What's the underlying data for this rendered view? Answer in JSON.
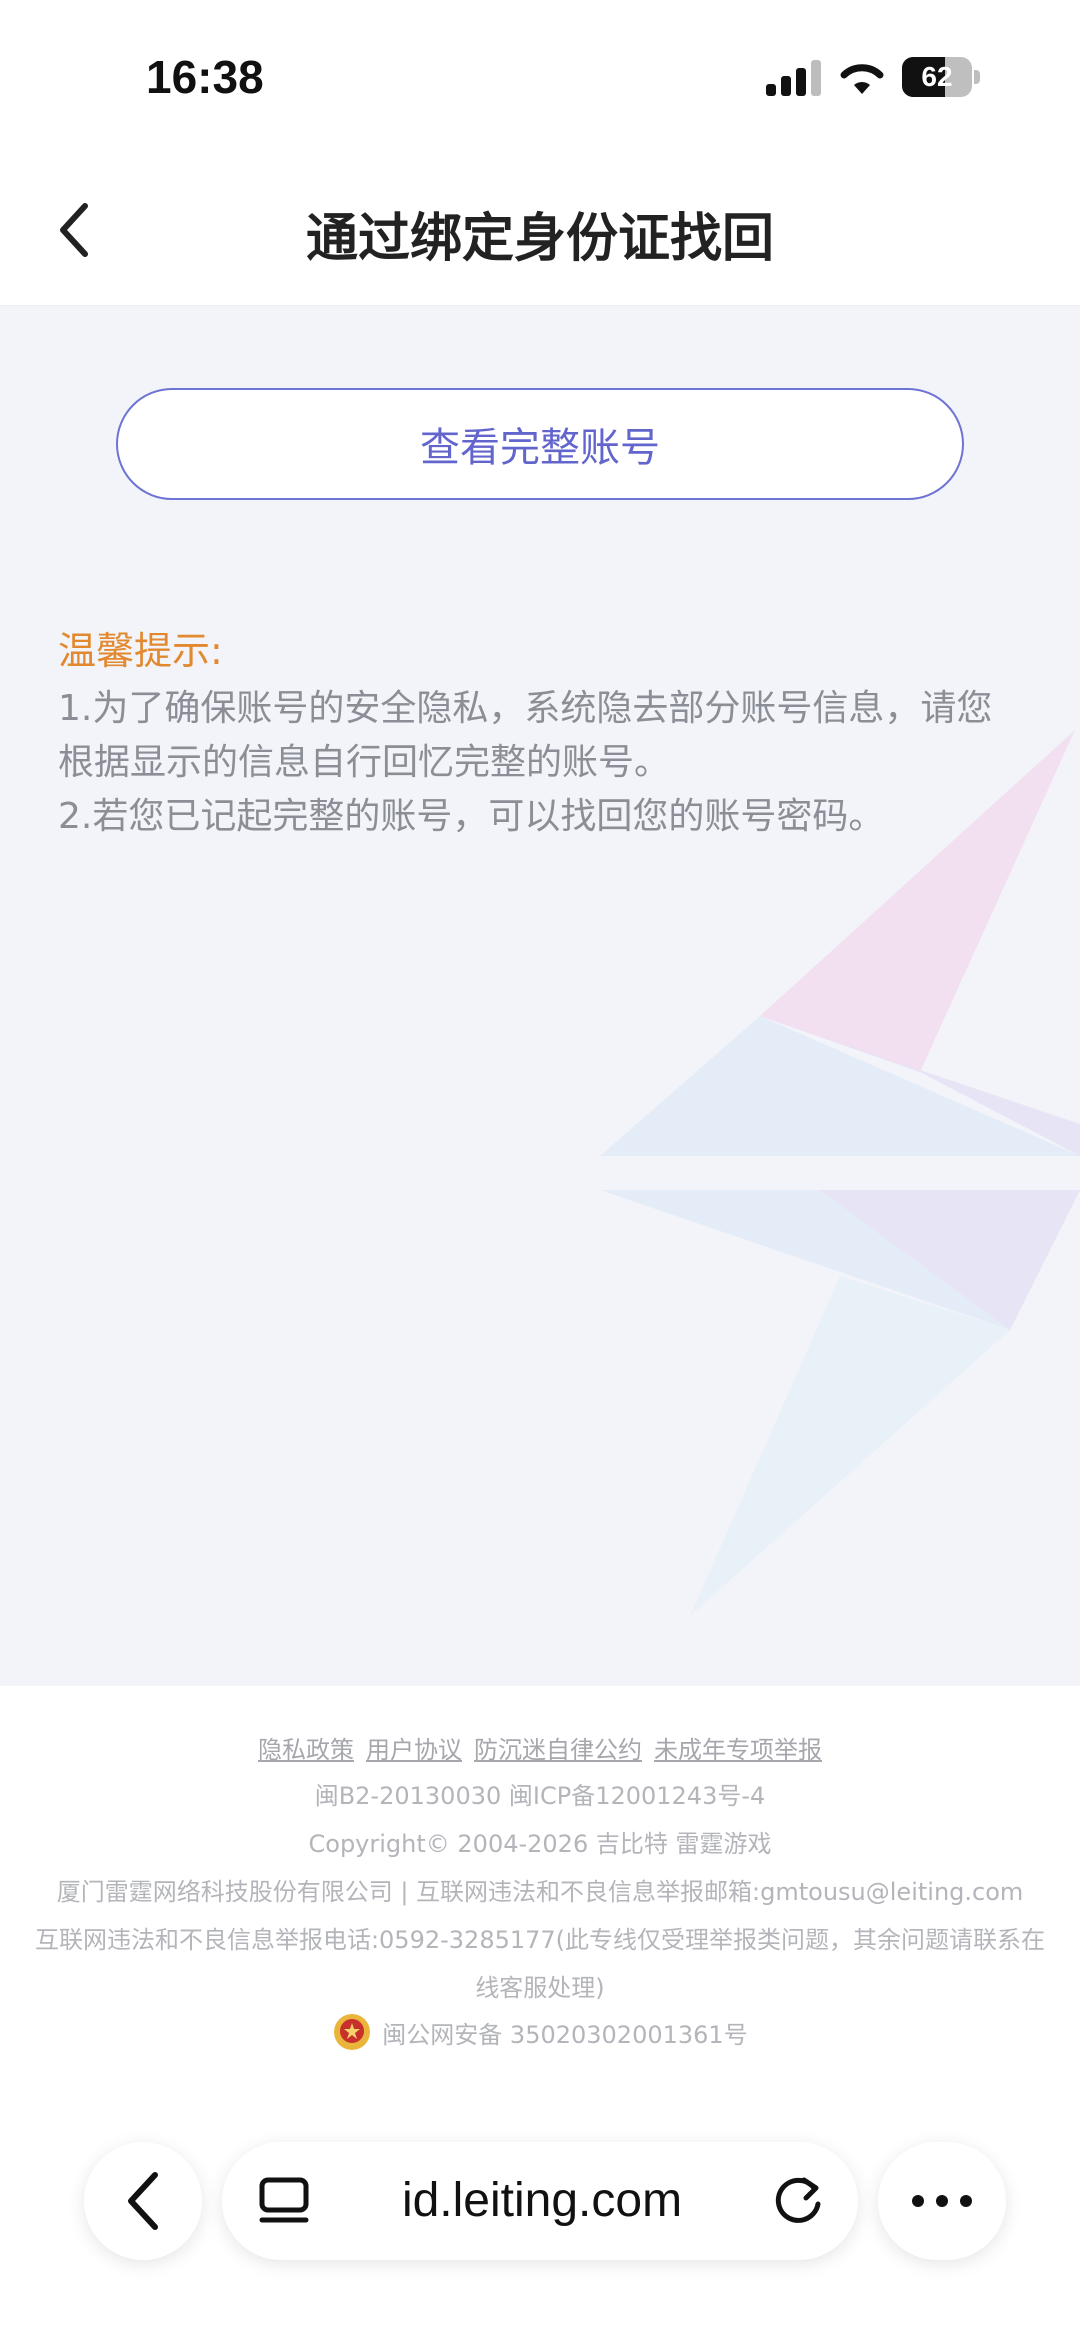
{
  "status_bar": {
    "time": "16:38",
    "battery": "62",
    "battery_level": 0.62,
    "icons": [
      "signal-icon",
      "wifi-icon",
      "battery-icon"
    ]
  },
  "header": {
    "title": "通过绑定身份证找回",
    "back_icon": "chevron-left-icon"
  },
  "main": {
    "view_account_button": "查看完整账号",
    "tips_title": "温馨提示:",
    "tips": [
      "1.为了确保账号的安全隐私，系统隐去部分账号信息，请您根据显示的信息自行回忆完整的账号。",
      "2.若您已记起完整的账号，可以找回您的账号密码。"
    ]
  },
  "footer": {
    "links": [
      "隐私政策",
      "用户协议",
      "防沉迷自律公约",
      "未成年专项举报"
    ],
    "license": "闽B2-20130030  闽ICP备12001243号-4",
    "copyright": "Copyright© 2004-2026  吉比特  雷霆游戏",
    "company": "厦门雷霆网络科技股份有限公司 | 互联网违法和不良信息举报邮箱:gmtousu@leiting.com",
    "report_phone": "互联网违法和不良信息举报电话:0592-3285177(此专线仅受理举报类问题，其余问题请联系在线客服处理)",
    "police_record": "闽公网安备 35020302001361号"
  },
  "browser_bar": {
    "url": "id.leiting.com",
    "icons": [
      "back-icon",
      "tabs-icon",
      "reload-icon",
      "more-icon"
    ]
  },
  "colors": {
    "accent": "#6266cc",
    "tips_title": "#e2892f",
    "main_bg": "#f3f4f9"
  }
}
